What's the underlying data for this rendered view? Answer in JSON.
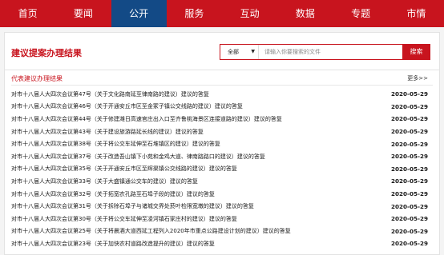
{
  "nav": {
    "items": [
      {
        "label": "首页"
      },
      {
        "label": "要闻"
      },
      {
        "label": "公开"
      },
      {
        "label": "服务"
      },
      {
        "label": "互动"
      },
      {
        "label": "数据"
      },
      {
        "label": "专题"
      },
      {
        "label": "市情"
      }
    ],
    "active_index": 2
  },
  "page": {
    "title": "建议提案办理结果"
  },
  "search": {
    "scope": "全部",
    "placeholder": "请输入你要搜索的文件",
    "button_label": "搜索"
  },
  "section": {
    "title": "代表建议办理结果",
    "more_label": "更多>>"
  },
  "rows": [
    {
      "title": "对市十八届人大四次会议第47号（关于文化路南延至律南路的建议）建议的答复",
      "date": "2020-05-29"
    },
    {
      "title": "对市十八届人大四次会议第46号（关于开通安丘市区至金冢子镇公交线路的建议）建议的答复",
      "date": "2020-05-29"
    },
    {
      "title": "对市十八届人大四次会议第44号（关于修建潍日高速官庄出入口至齐鲁桃海景区连接道路的建议）建议的答复",
      "date": "2020-05-29"
    },
    {
      "title": "对市十八届人大四次会议第43号（关于建设旅游路延长线的建议）建议的答复",
      "date": "2020-05-29"
    },
    {
      "title": "对市十八届人大四次会议第38号（关于将公交车延伸至石堆镇区的建议）建议的答复",
      "date": "2020-05-29"
    },
    {
      "title": "对市十八届人大四次会议第37号（关于改造吾山镇下小苑和金鸡大道、律南路路口的建议）建议的答复",
      "date": "2020-05-29"
    },
    {
      "title": "对市十八届人大四次会议第35号（关于开通安丘市区至辉渠镇公交线路的建议）建议的答复",
      "date": "2020-05-29"
    },
    {
      "title": "对市十八届人大四次会议第33号（关于大盛镇通公交车的建议）建议的答复",
      "date": "2020-05-29"
    },
    {
      "title": "对市十八届人大四次会议第32号（关于拓宽农孔路至石埠子段的建议）建议的答复",
      "date": "2020-05-29"
    },
    {
      "title": "对市十八届人大四次会议第31号（关于拆除石埠子与诸城交界处菸叶检限宽墩的建议）建议的答复",
      "date": "2020-05-29"
    },
    {
      "title": "对市十八届人大四次会议第30号（关于将公交车延伸至凌河镇石家庄村的建议）建议的答复",
      "date": "2020-05-29"
    },
    {
      "title": "对市十八届人大四次会议第25号（关于将晨酒大道西延工程列入2020年市重点公路建设计划的建议）建议的答复",
      "date": "2020-05-29"
    },
    {
      "title": "对市十八届人大四次会议第23号（关于加快农村道路改造提升的建议）建议的答复",
      "date": "2020-05-29"
    }
  ]
}
